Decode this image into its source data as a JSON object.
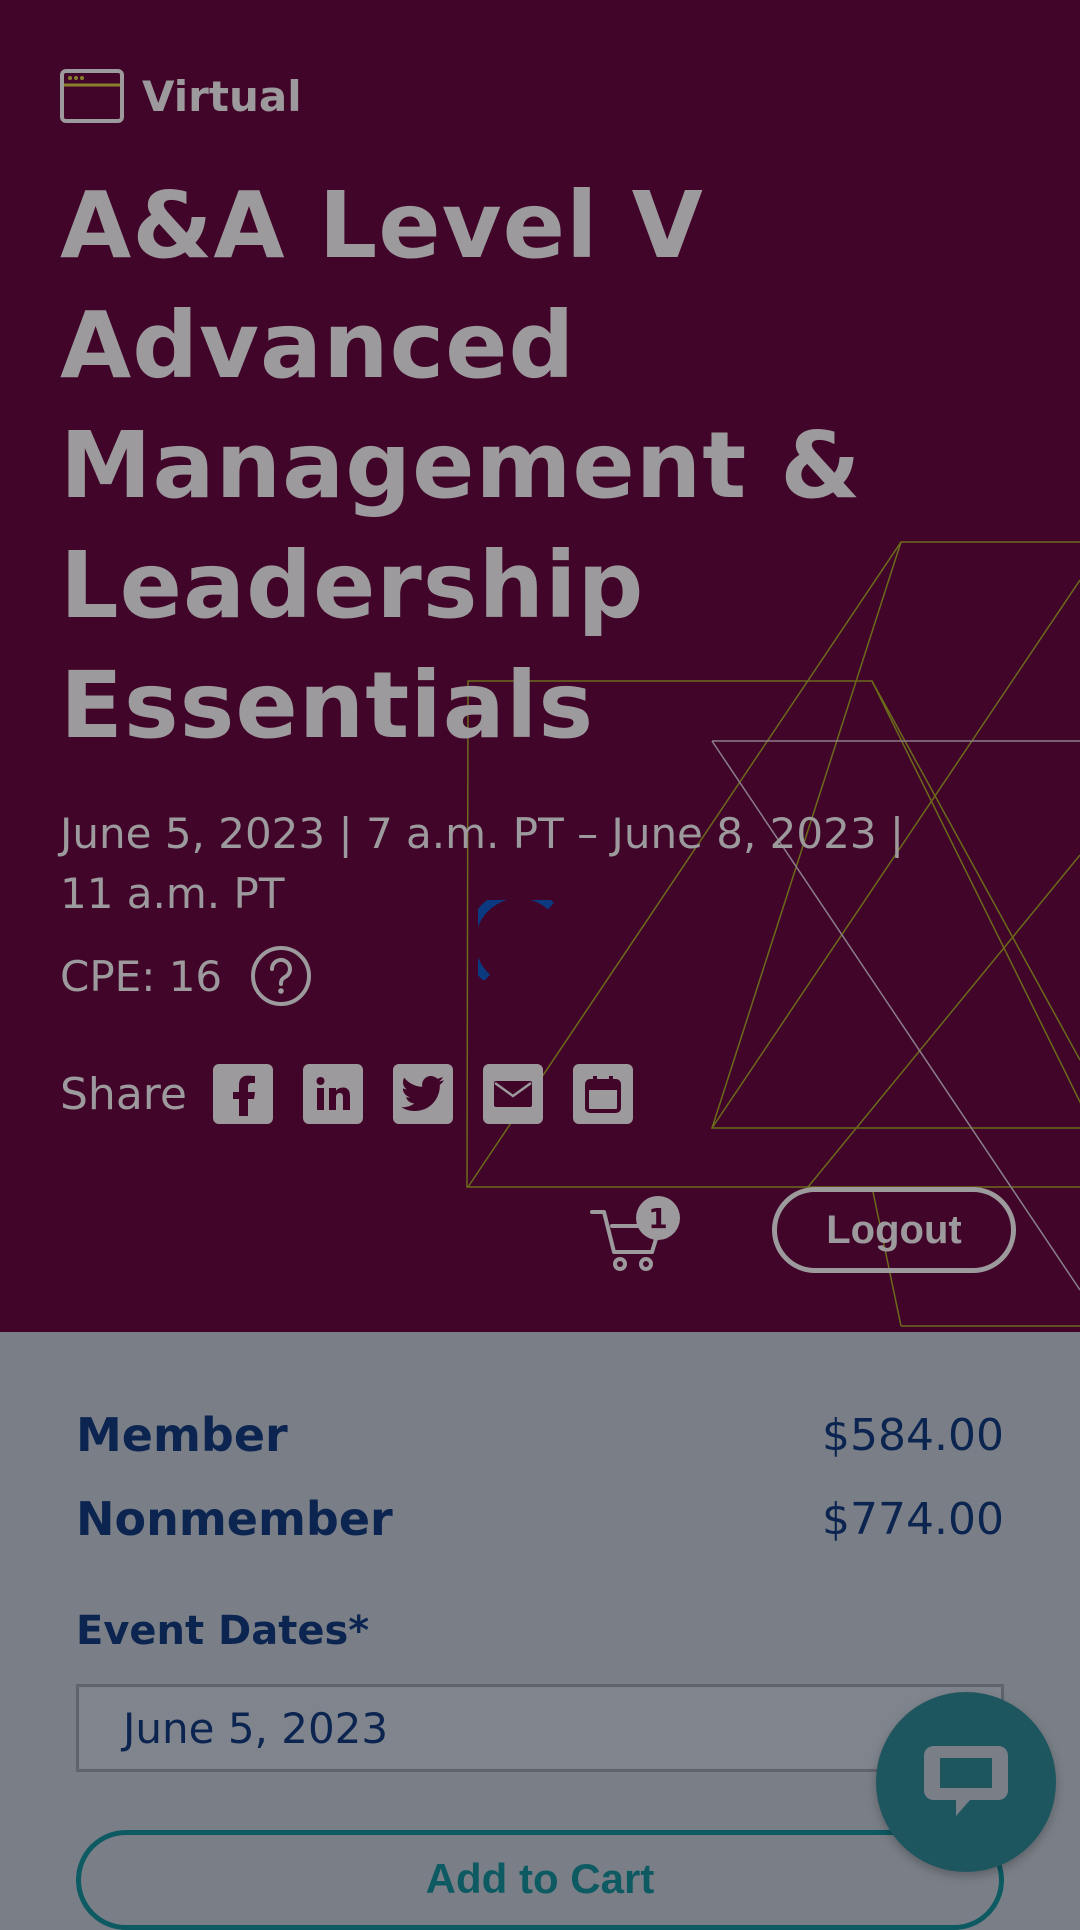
{
  "event": {
    "format_label": "Virtual",
    "title_lines": [
      "A&A Level V",
      "Advanced",
      "Management &",
      "Leadership",
      "Essentials"
    ],
    "dates": "June 5, 2023 | 7 a.m. PT – June 8, 2023 | 11 a.m. PT",
    "cpe": "CPE: 16",
    "share_label": "Share"
  },
  "share_icons": [
    "facebook-icon",
    "linkedin-icon",
    "twitter-icon",
    "email-icon",
    "calendar-icon"
  ],
  "header": {
    "cart_count": "1",
    "logout_label": "Logout"
  },
  "pricing": {
    "member_label": "Member",
    "member_price": "$584.00",
    "nonmember_label": "Nonmember",
    "nonmember_price": "$774.00"
  },
  "form": {
    "event_dates_label": "Event Dates*",
    "event_date_value": "June 5, 2023",
    "add_to_cart_label": "Add to Cart"
  },
  "colors": {
    "hero_bg": "#41052a",
    "overlay_bg": "#7a7f87",
    "text_muted": "#9c9a9c",
    "navy": "#0b2450",
    "teal": "#0d5a63",
    "chat_bg": "#1e5660",
    "spinner": "#0b3a80"
  }
}
